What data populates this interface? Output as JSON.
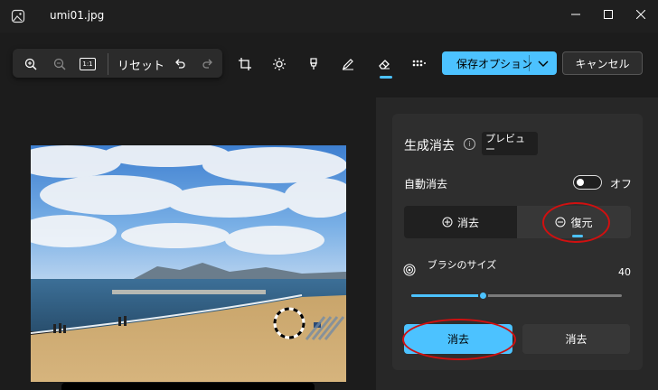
{
  "window": {
    "title": "umi01.jpg",
    "app_icon": "photos-icon",
    "controls": [
      "minimize-icon",
      "maximize-icon",
      "close-icon"
    ]
  },
  "toolbar": {
    "tools": [
      "zoom-in-icon",
      "zoom-out-icon",
      "actual-size-icon"
    ],
    "actual_size_label": "1:1",
    "reset_label": "リセット",
    "history": [
      "undo-icon",
      "redo-icon"
    ],
    "edit_tools": [
      "crop-icon",
      "adjust-icon",
      "filter-icon",
      "markup-icon",
      "erase-icon",
      "background-blur-icon"
    ],
    "active_tool": "erase-icon",
    "save_label": "保存オプション",
    "cancel_label": "キャンセル"
  },
  "panel": {
    "title": "生成消去",
    "preview_badge": "プレビュー",
    "auto_erase_label": "自動消去",
    "auto_erase_state": "オフ",
    "mode_erase_label": "消去",
    "mode_restore_label": "復元",
    "selected_mode": "restore",
    "brush_label": "ブラシのサイズ",
    "brush_value": "40",
    "brush_slider_fraction": 0.34,
    "erase_primary_label": "消去",
    "erase_secondary_label": "消去"
  },
  "colors": {
    "accent": "#4cc2ff",
    "background": "#1c1c1c",
    "panel": "#272727",
    "annotation": "#d01010"
  }
}
